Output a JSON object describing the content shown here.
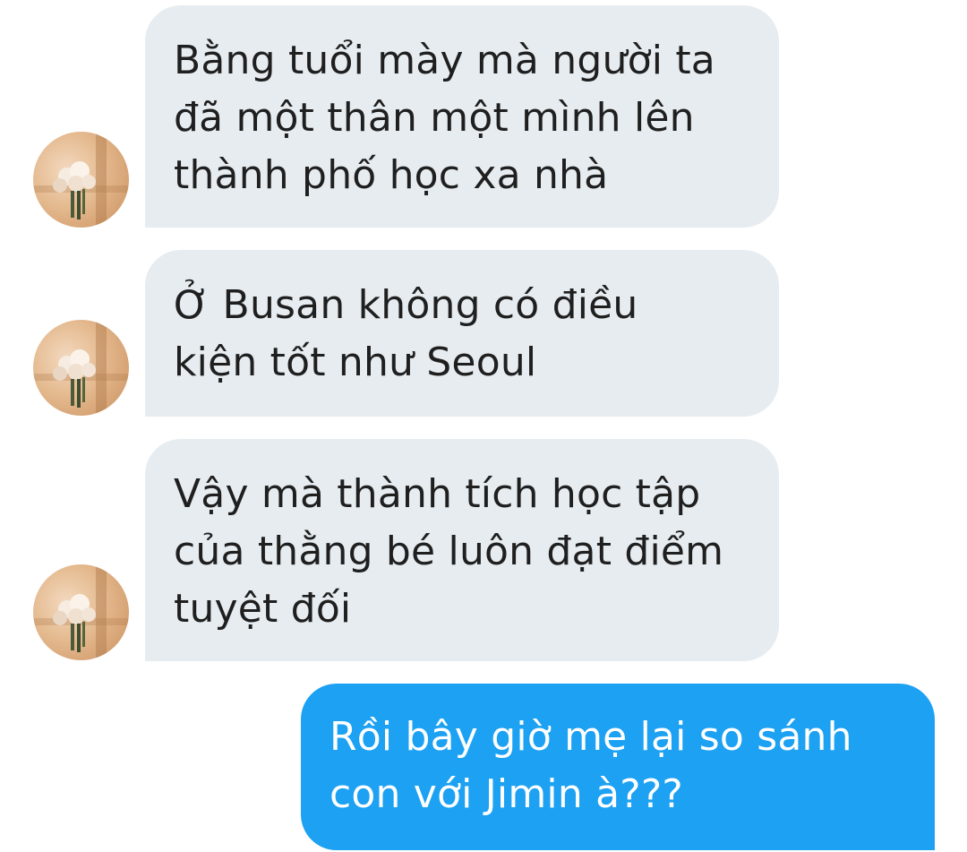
{
  "conversation": {
    "messages": [
      {
        "sender": "other",
        "text": "Bằng tuổi mày mà người ta\nđã một thân một mình lên\nthành phố học xa nhà"
      },
      {
        "sender": "other",
        "text": "Ở Busan không có điều\nkiện tốt như Seoul"
      },
      {
        "sender": "other",
        "text": "Vậy mà thành tích học tập\ncủa thằng bé luôn đạt điểm\ntuyệt đối"
      },
      {
        "sender": "me",
        "text": "Rồi bây giờ mẹ lại so sánh\ncon với Jimin à???"
      }
    ]
  },
  "colors": {
    "incoming_bubble": "#e6ecf0",
    "outgoing_bubble": "#1da1f2",
    "incoming_text": "#1f1f1f",
    "outgoing_text": "#ffffff"
  },
  "avatar": {
    "icon": "flower-bouquet-photo"
  }
}
